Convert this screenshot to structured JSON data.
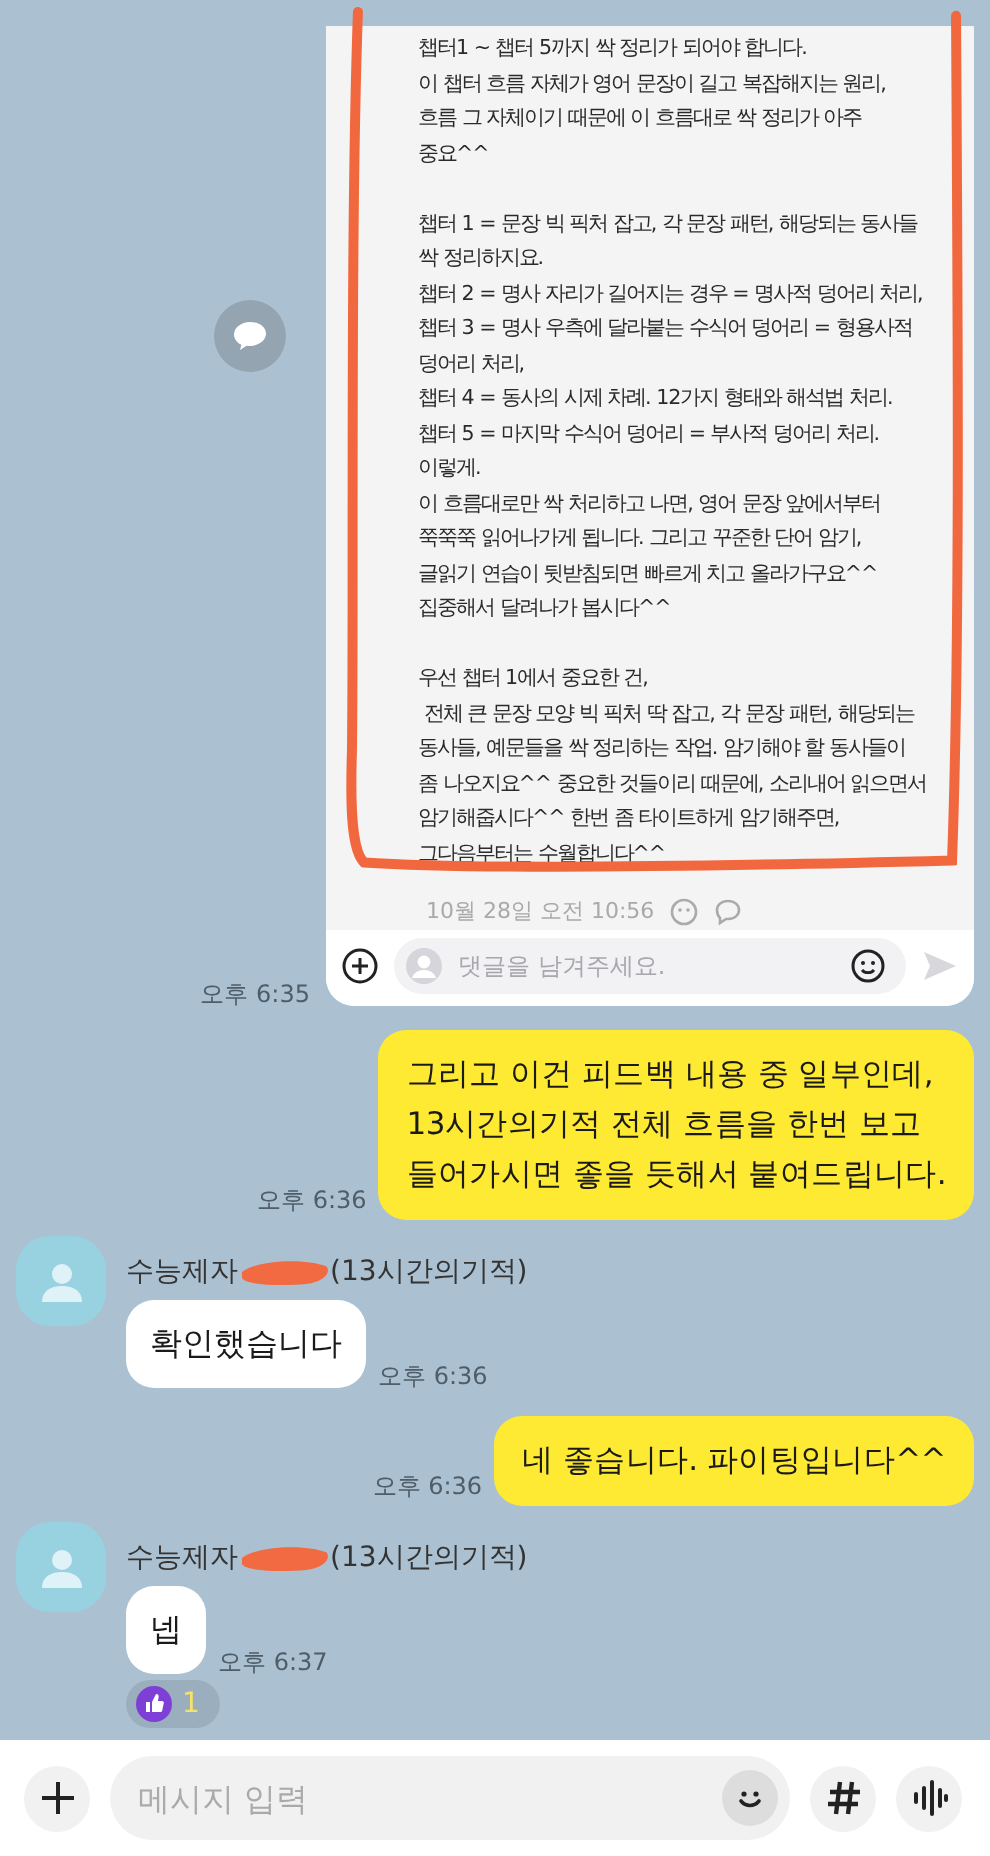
{
  "shared_image": {
    "paragraphs": [
      {
        "lines": [
          "챕터1 ~ 챕터 5까지 싹 정리가 되어야 합니다.",
          "이 챕터 흐름 자체가 영어 문장이 길고 복잡해지는 원리,",
          "흐름 그 자체이기 때문에 이 흐름대로 싹 정리가 아주",
          "중요^^"
        ]
      },
      {
        "lines": [
          "챕터 1 = 문장 빅 픽처 잡고, 각 문장 패턴, 해당되는 동사들",
          "싹 정리하지요.",
          "챕터 2 = 명사 자리가 길어지는 경우 = 명사적 덩어리 처리,",
          "챕터 3 = 명사 우측에 달라붙는 수식어 덩어리 = 형용사적",
          "덩어리 처리,",
          "챕터 4 = 동사의 시제 차례. 12가지 형태와 해석법 처리.",
          "챕터 5 = 마지막 수식어 덩어리 = 부사적 덩어리 처리.",
          "이렇게.",
          "이 흐름대로만 싹 처리하고 나면, 영어 문장 앞에서부터",
          "쭉쭉쭉 읽어나가게 됩니다. 그리고 꾸준한 단어 암기,",
          "글읽기 연습이 뒷받침되면 빠르게 치고 올라가구요^^",
          "집중해서 달려나가 봅시다^^"
        ]
      },
      {
        "lines": [
          "우선 챕터 1에서 중요한 건,",
          " 전체 큰 문장 모양 빅 픽처 딱 잡고, 각 문장 패턴, 해당되는",
          "동사들, 예문들을 싹 정리하는 작업. 암기해야 할 동사들이",
          "좀 나오지요^^ 중요한 것들이리 때문에, 소리내어 읽으면서",
          "암기해줍시다^^ 한번 좀 타이트하게 암기해주면,",
          "그다음부터는 수월합니다^^"
        ]
      }
    ],
    "comment_date": "10월 28일 오전 10:56",
    "comment_placeholder": "댓글을 남겨주세요.",
    "time": "오후 6:35"
  },
  "messages": [
    {
      "kind": "sent",
      "text": "그리고 이건 피드백 내용 중 일부인데,\n13시간의기적 전체 흐름을 한번 보고\n들어가시면 좋을 듯해서 붙여드립니다.",
      "time": "오후 6:36"
    },
    {
      "kind": "received",
      "sender_prefix": "수능제자",
      "sender_suffix": "(13시간의기적)",
      "text": "확인했습니다",
      "time": "오후 6:36"
    },
    {
      "kind": "sent",
      "text": "네 좋습니다. 파이팅입니다^^",
      "time": "오후 6:36"
    },
    {
      "kind": "received",
      "sender_prefix": "수능제자",
      "sender_suffix": "(13시간의기적)",
      "text": "넵",
      "time": "오후 6:37",
      "reaction_count": "1"
    }
  ],
  "composer": {
    "placeholder": "메시지 입력"
  }
}
